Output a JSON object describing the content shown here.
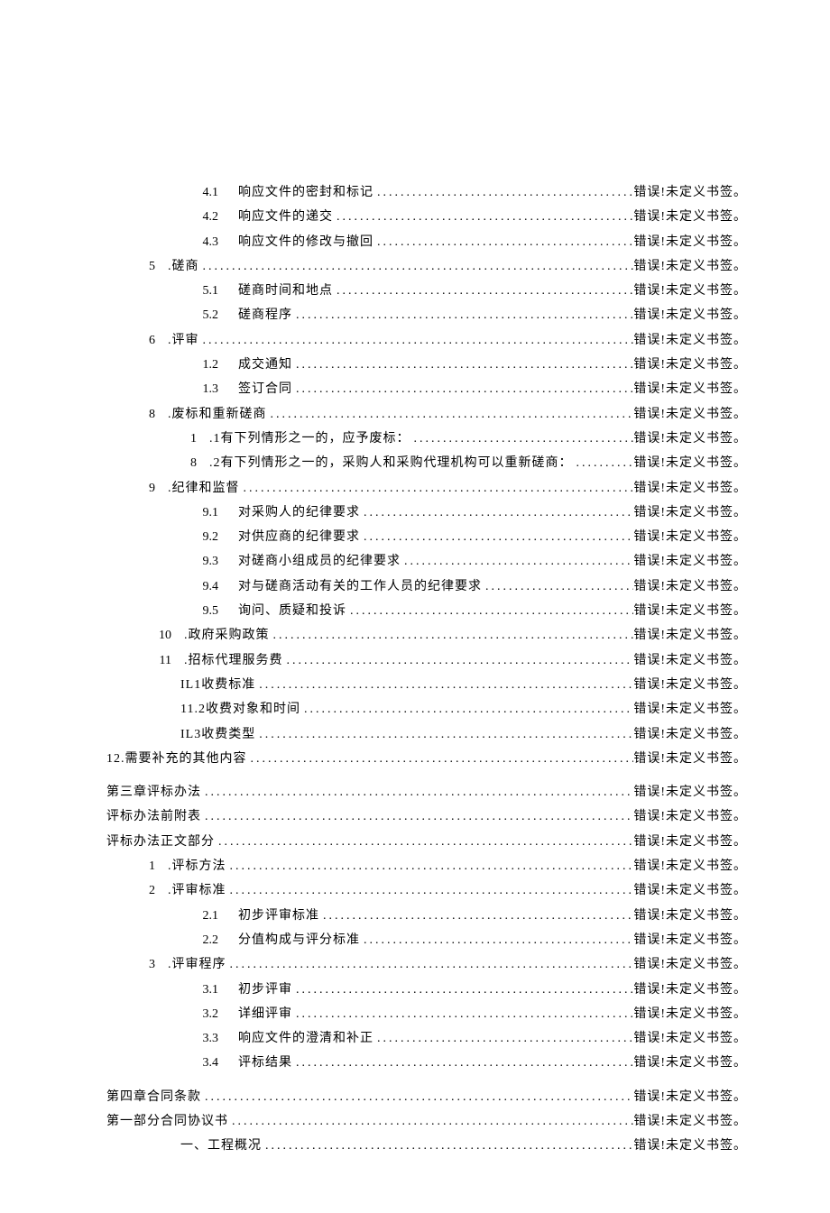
{
  "err": "错误!未定义书签。",
  "items": [
    {
      "lv": 2,
      "num": "4.1",
      "txt": "响应文件的密封和标记"
    },
    {
      "lv": 2,
      "num": "4.2",
      "txt": "响应文件的递交"
    },
    {
      "lv": 2,
      "num": "4.3",
      "txt": "响应文件的修改与撤回"
    },
    {
      "lv": 1,
      "num": "5",
      "txt": ".磋商"
    },
    {
      "lv": 2,
      "num": "5.1",
      "txt": "磋商时间和地点"
    },
    {
      "lv": 2,
      "num": "5.2",
      "txt": "磋商程序"
    },
    {
      "lv": 1,
      "num": "6",
      "txt": ".评审"
    },
    {
      "lv": 2,
      "num": "1.2",
      "txt": "成交通知"
    },
    {
      "lv": 2,
      "num": "1.3",
      "txt": "签订合同"
    },
    {
      "lv": 1,
      "num": "8",
      "txt": ".废标和重新磋商"
    },
    {
      "lv": 2,
      "num": "1",
      "txt": ".1有下列情形之一的，应予废标："
    },
    {
      "lv": 2,
      "num": "8",
      "txt": ".2有下列情形之一的，采购人和采购代理机构可以重新磋商："
    },
    {
      "lv": 1,
      "num": "9",
      "txt": ".纪律和监督"
    },
    {
      "lv": 2,
      "num": "9.1",
      "txt": "对采购人的纪律要求"
    },
    {
      "lv": 2,
      "num": "9.2",
      "txt": "对供应商的纪律要求"
    },
    {
      "lv": 2,
      "num": "9.3",
      "txt": "对磋商小组成员的纪律要求"
    },
    {
      "lv": 2,
      "num": "9.4",
      "txt": "对与磋商活动有关的工作人员的纪律要求"
    },
    {
      "lv": 2,
      "num": "9.5",
      "txt": "询问、质疑和投诉"
    },
    {
      "lv": 1,
      "num": "10",
      "txt": ".政府采购政策"
    },
    {
      "lv": 1,
      "num": "11",
      "txt": ".招标代理服务费"
    },
    {
      "lv": 2,
      "num": "",
      "txt": "IL1收费标准"
    },
    {
      "lv": 2,
      "num": "",
      "txt": "11.2收费对象和时间"
    },
    {
      "lv": 2,
      "num": "",
      "txt": "IL3收费类型"
    },
    {
      "lv": 0,
      "num": "",
      "txt": "12.需要补充的其他内容"
    }
  ],
  "title3": "第三章评标办法",
  "sec3": [
    {
      "lv": 0,
      "num": "",
      "txt": "评标办法前附表"
    },
    {
      "lv": 0,
      "num": "",
      "txt": "评标办法正文部分"
    },
    {
      "lv": 1,
      "num": "1",
      "txt": ".评标方法"
    },
    {
      "lv": 1,
      "num": "2",
      "txt": ".评审标准"
    },
    {
      "lv": 2,
      "num": "2.1",
      "txt": "初步评审标准"
    },
    {
      "lv": 2,
      "num": "2.2",
      "txt": "分值构成与评分标准"
    },
    {
      "lv": 1,
      "num": "3",
      "txt": ".评审程序"
    },
    {
      "lv": 2,
      "num": "3.1",
      "txt": "初步评审"
    },
    {
      "lv": 2,
      "num": "3.2",
      "txt": "详细评审"
    },
    {
      "lv": 2,
      "num": "3.3",
      "txt": "响应文件的澄清和补正"
    },
    {
      "lv": 2,
      "num": "3.4",
      "txt": "评标结果"
    }
  ],
  "title4": "第四章合同条款",
  "sec4": [
    {
      "lv": 0,
      "num": "",
      "txt": "第一部分合同协议书"
    },
    {
      "lv": 2,
      "num": "",
      "txt": "一、工程概况"
    }
  ]
}
